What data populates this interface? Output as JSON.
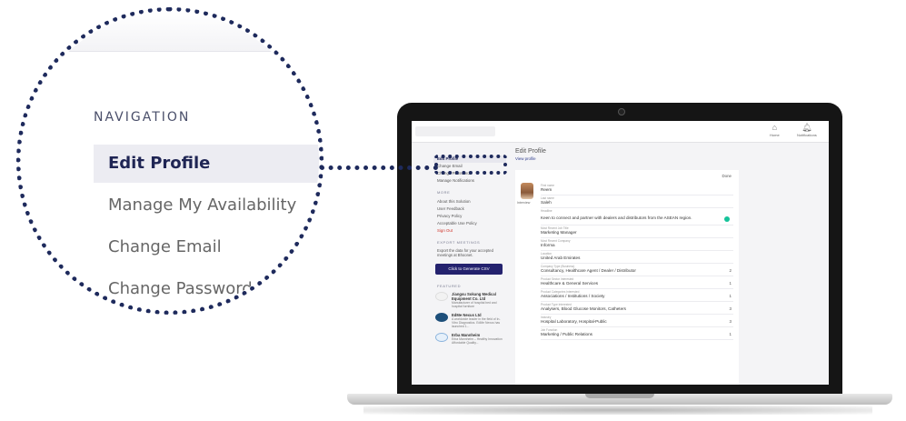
{
  "zoom": {
    "nav_title": "NAVIGATION",
    "items": [
      "Edit Profile",
      "Manage My Availability",
      "Change Email",
      "Change Password"
    ]
  },
  "app": {
    "header": {
      "home_label": "Home",
      "notifications_label": "Notifications"
    },
    "sidebar": {
      "nav_items": [
        "Edit Profile",
        "Change Email",
        "Change Password",
        "Manage Notifications"
      ],
      "more_title": "MORE",
      "more_items": [
        "About this Solution",
        "User Feedback",
        "Privacy Policy",
        "Acceptable Use Policy"
      ],
      "sign_out": "Sign Out",
      "export_title": "EXPORT MEETINGS",
      "export_text": "Export the data for your accepted meetings at Bhoonet.",
      "generate_button": "Click to Generate CSV",
      "featured_title": "FEATURED",
      "featured": [
        {
          "name": "Jiangsu Sokung Medical Equipment Co. Ltd",
          "desc": "Manufacturer of hospital bed and hospital furniture"
        },
        {
          "name": "EdMe Nexus Ltd",
          "desc": "A worldwide leader in the field of In-Vitro Diagnostics. EdMe Nexus has launched 1..."
        },
        {
          "name": "Erba Mannheim",
          "desc": "Erba Mannheim – Healthy Innovation Affordable Quality..."
        }
      ]
    },
    "main": {
      "title": "Edit Profile",
      "view_link": "View profile",
      "done_link": "Done",
      "avatar_label": "Interview",
      "fields": [
        {
          "label": "First name",
          "value": "Reem",
          "count": ""
        },
        {
          "label": "Last name",
          "value": "Saleh",
          "count": ""
        },
        {
          "label": "Headline",
          "value": "Keen to connect and partner with dealers and distributors from the ASEAN region.",
          "count": ""
        },
        {
          "label": "Most Recent Job Title",
          "value": "Marketing Manager",
          "count": ""
        },
        {
          "label": "Most Recent Company",
          "value": "Informa",
          "count": ""
        },
        {
          "label": "Location",
          "value": "United Arab Emirates",
          "count": ""
        },
        {
          "label": "Company Type (Business)",
          "value": "Consultancy, Healthcare Agent / Dealer / Distributor",
          "count": "2"
        },
        {
          "label": "Product Sector Interested",
          "value": "Healthcare & General Services",
          "count": "1"
        },
        {
          "label": "Product Categories Interested",
          "value": "Associations / Institutions / Society",
          "count": "1"
        },
        {
          "label": "Product Type Interested",
          "value": "Analysers, Blood Glucose Monitors, Catheters",
          "count": "3"
        },
        {
          "label": "Industry",
          "value": "Hospital Laboratory, Hospital-Public",
          "count": "3"
        },
        {
          "label": "Job Function",
          "value": "Marketing / Public Relations",
          "count": "1"
        }
      ]
    }
  },
  "colors": {
    "navy": "#1e2a5c",
    "button": "#24226e",
    "danger": "#d0352b"
  }
}
